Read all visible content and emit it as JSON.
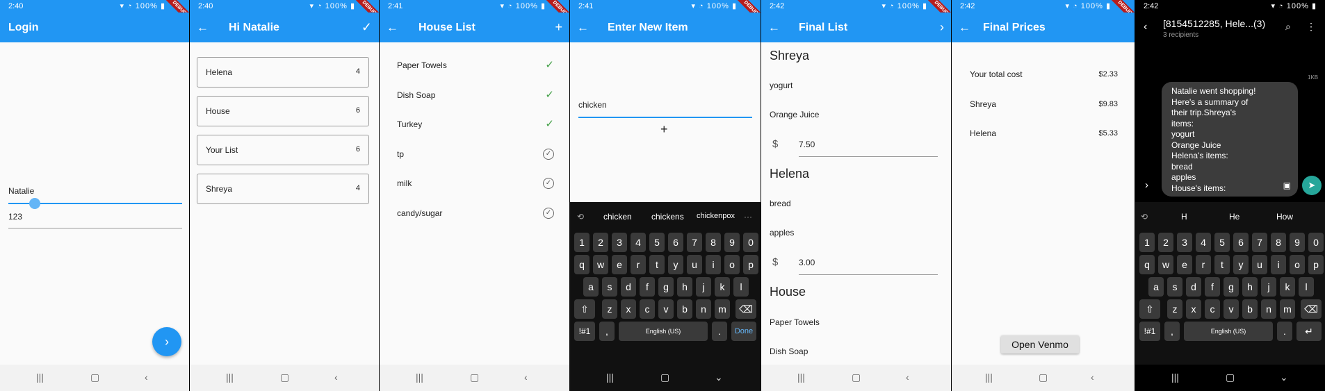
{
  "screens": [
    {
      "time": "2:40",
      "title": "Login",
      "name_label": "Natalie",
      "pin_value": "123",
      "fab_icon": "chevron-right"
    },
    {
      "time": "2:40",
      "title": "Hi Natalie",
      "lists": [
        {
          "name": "Helena",
          "count": "4"
        },
        {
          "name": "House",
          "count": "6"
        },
        {
          "name": "Your List",
          "count": "6"
        },
        {
          "name": "Shreya",
          "count": "4"
        }
      ]
    },
    {
      "time": "2:41",
      "title": "House List",
      "items": [
        {
          "name": "Paper Towels",
          "done": true
        },
        {
          "name": "Dish Soap",
          "done": true
        },
        {
          "name": "Turkey",
          "done": true
        },
        {
          "name": "tp",
          "done": false
        },
        {
          "name": "milk",
          "done": false
        },
        {
          "name": "candy/sugar",
          "done": false
        }
      ]
    },
    {
      "time": "2:41",
      "title": "Enter New Item",
      "input_value": "chicken",
      "add_label": "+",
      "suggestions": [
        "chicken",
        "chickens",
        "chickenpox"
      ],
      "keyboard": {
        "numbers": [
          "1",
          "2",
          "3",
          "4",
          "5",
          "6",
          "7",
          "8",
          "9",
          "0"
        ],
        "row1": [
          "q",
          "w",
          "e",
          "r",
          "t",
          "y",
          "u",
          "i",
          "o",
          "p"
        ],
        "row2": [
          "a",
          "s",
          "d",
          "f",
          "g",
          "h",
          "j",
          "k",
          "l"
        ],
        "row3": [
          "z",
          "x",
          "c",
          "v",
          "b",
          "n",
          "m"
        ],
        "sym": "!#1",
        "comma": ",",
        "space": "English (US)",
        "period": ".",
        "done": "Done"
      }
    },
    {
      "time": "2:42",
      "title": "Final List",
      "currency": "$",
      "sections": [
        {
          "name": "Shreya",
          "items": [
            "yogurt",
            "Orange Juice"
          ],
          "price": "7.50"
        },
        {
          "name": "Helena",
          "items": [
            "bread",
            "apples"
          ],
          "price": "3.00"
        },
        {
          "name": "House",
          "items": [
            "Paper Towels",
            "Dish Soap"
          ]
        }
      ]
    },
    {
      "time": "2:42",
      "title": "Final Prices",
      "rows": [
        {
          "label": "Your total cost",
          "value": "$2.33"
        },
        {
          "label": "Shreya",
          "value": "$9.83"
        },
        {
          "label": "Helena",
          "value": "$5.33"
        }
      ],
      "button": "Open Venmo"
    },
    {
      "time": "2:42",
      "title": "[8154512285, Hele...(3)",
      "subtitle": "3 recipients",
      "size_tag": "1KB",
      "message_lines": [
        "Natalie went shopping!",
        "Here's a summary of",
        "their trip.Shreya's",
        "items:",
        "yogurt",
        "Orange Juice",
        "Helena's items:",
        "bread",
        "apples",
        "House's items:"
      ],
      "suggestions": [
        "H",
        "He",
        "How"
      ],
      "keyboard": {
        "numbers": [
          "1",
          "2",
          "3",
          "4",
          "5",
          "6",
          "7",
          "8",
          "9",
          "0"
        ],
        "row1": [
          "q",
          "w",
          "e",
          "r",
          "t",
          "y",
          "u",
          "i",
          "o",
          "p"
        ],
        "row2": [
          "a",
          "s",
          "d",
          "f",
          "g",
          "h",
          "j",
          "k",
          "l"
        ],
        "row3": [
          "z",
          "x",
          "c",
          "v",
          "b",
          "n",
          "m"
        ],
        "sym": "!#1",
        "comma": ",",
        "space": "English (US)",
        "period": "."
      }
    }
  ],
  "status": {
    "battery": "100%",
    "debug": "DEBUG"
  },
  "colors": {
    "primary": "#2196f3",
    "check": "#43a047"
  }
}
